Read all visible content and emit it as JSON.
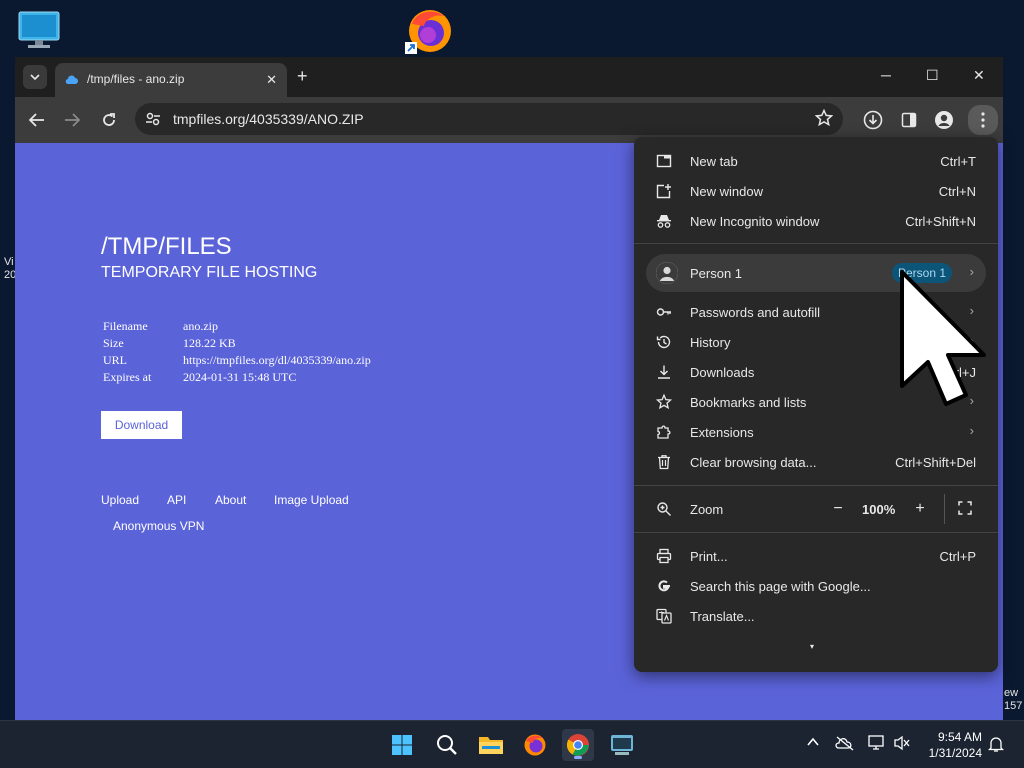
{
  "desktop": {
    "left_edge_text": [
      "Vi",
      "20"
    ],
    "right_edge_text": [
      "ew",
      "157"
    ]
  },
  "browser": {
    "tab": {
      "title": "/tmp/files - ano.zip"
    },
    "window_controls": {
      "minimize": "─",
      "maximize": "☐",
      "close": "✕"
    },
    "toolbar": {
      "url": "tmpfiles.org/4035339/ANO.ZIP"
    }
  },
  "page": {
    "title": "/TMP/FILES",
    "subtitle": "TEMPORARY FILE HOSTING",
    "info": [
      {
        "key": "Filename",
        "value": "ano.zip"
      },
      {
        "key": "Size",
        "value": "128.22 KB"
      },
      {
        "key": "URL",
        "value": "https://tmpfiles.org/dl/4035339/ano.zip"
      },
      {
        "key": "Expires at",
        "value": "2024-01-31 15:48 UTC"
      }
    ],
    "download_label": "Download",
    "footer_links": [
      "Upload",
      "API",
      "About",
      "Image Upload",
      "Anonymous VPN"
    ]
  },
  "menu": {
    "items": [
      {
        "label": "New tab",
        "shortcut": "Ctrl+T",
        "icon": "new-tab-icon"
      },
      {
        "label": "New window",
        "shortcut": "Ctrl+N",
        "icon": "new-window-icon"
      },
      {
        "label": "New Incognito window",
        "shortcut": "Ctrl+Shift+N",
        "icon": "incognito-icon"
      }
    ],
    "profile": {
      "label": "Person 1",
      "chip": "Person 1"
    },
    "items2": [
      {
        "label": "Passwords and autofill",
        "shortcut": "",
        "icon": "key-icon",
        "submenu": true
      },
      {
        "label": "History",
        "shortcut": "",
        "icon": "history-icon",
        "submenu": true
      },
      {
        "label": "Downloads",
        "shortcut": "Ctrl+J",
        "icon": "download-icon",
        "submenu": false
      },
      {
        "label": "Bookmarks and lists",
        "shortcut": "",
        "icon": "star-icon",
        "submenu": true
      },
      {
        "label": "Extensions",
        "shortcut": "",
        "icon": "puzzle-icon",
        "submenu": true
      },
      {
        "label": "Clear browsing data...",
        "shortcut": "Ctrl+Shift+Del",
        "icon": "trash-icon",
        "submenu": false
      }
    ],
    "zoom": {
      "label": "Zoom",
      "value": "100%",
      "minus": "−",
      "plus": "+"
    },
    "items3": [
      {
        "label": "Print...",
        "shortcut": "Ctrl+P",
        "icon": "print-icon"
      },
      {
        "label": "Search this page with Google...",
        "shortcut": "",
        "icon": "google-icon"
      },
      {
        "label": "Translate...",
        "shortcut": "",
        "icon": "translate-icon"
      }
    ],
    "more": "▾"
  },
  "taskbar": {
    "time": "9:54 AM",
    "date": "1/31/2024",
    "apps": [
      "start-icon",
      "search-icon",
      "file-explorer-icon",
      "firefox-icon",
      "chrome-icon",
      "terminal-icon"
    ]
  }
}
